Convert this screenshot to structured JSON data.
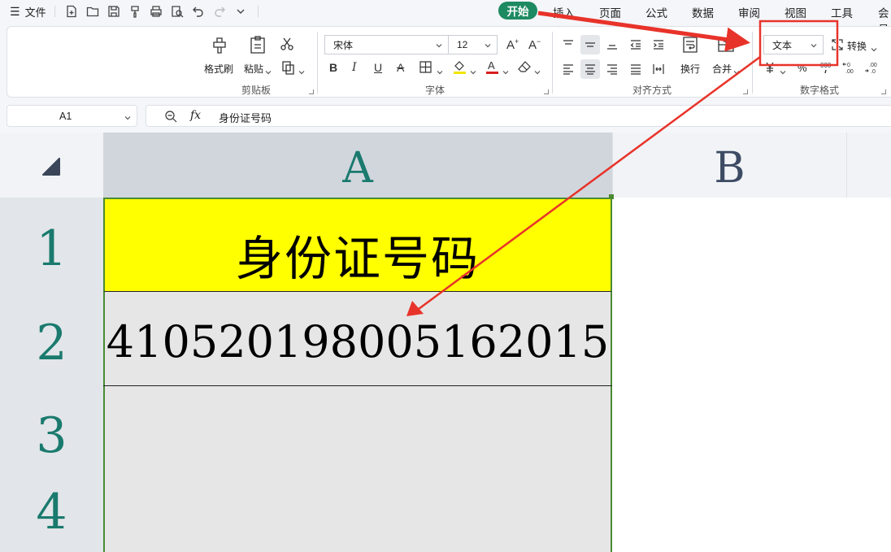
{
  "menubar": {
    "file_label": "文件",
    "tabs": [
      "开始",
      "插入",
      "页面",
      "公式",
      "数据",
      "审阅",
      "视图",
      "工具",
      "会员"
    ]
  },
  "ribbon": {
    "clipboard": {
      "format_painter": "格式刷",
      "paste": "粘贴",
      "group_label": "剪贴板"
    },
    "font": {
      "font_name": "宋体",
      "font_size": "12",
      "group_label": "字体"
    },
    "alignment": {
      "wrap": "换行",
      "merge": "合并",
      "group_label": "对齐方式"
    },
    "number": {
      "format_value": "文本",
      "convert": "转换",
      "percent": "%",
      "group_label": "数字格式"
    }
  },
  "formula_bar": {
    "name_box": "A1",
    "fx": "fx",
    "content": "身份证号码"
  },
  "grid": {
    "columns": [
      "A",
      "B"
    ],
    "rows": [
      "1",
      "2",
      "3",
      "4"
    ],
    "cells": {
      "A1": "身份证号码",
      "A2": "410520198005162015"
    }
  },
  "colors": {
    "accent": "#1e8a62",
    "header_fill": "#ffff00",
    "annotation": "#e8332a",
    "selection_border": "#4a8a34"
  }
}
